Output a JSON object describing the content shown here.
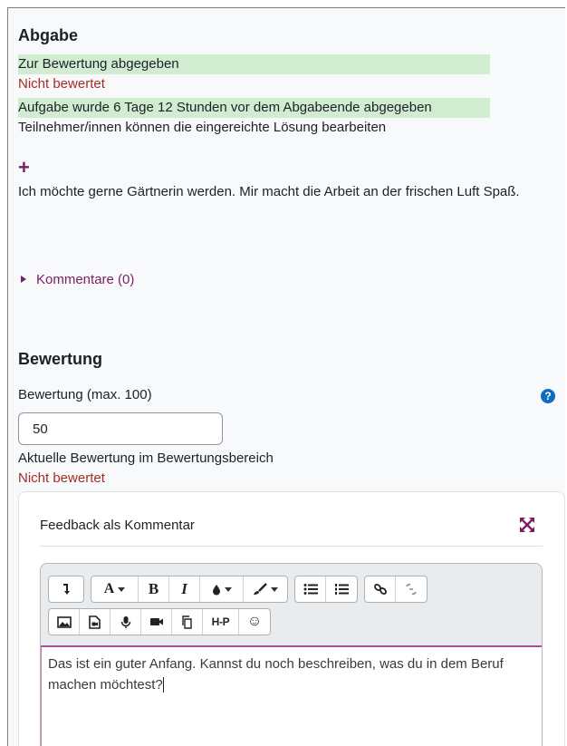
{
  "submission": {
    "heading": "Abgabe",
    "status_submitted": "Zur Bewertung abgegeben",
    "status_grading": "Nicht bewertet",
    "timing": "Aufgabe wurde 6 Tage 12 Stunden vor dem Abgabeende abgegeben",
    "editable": "Teilnehmer/innen können die eingereichte Lösung bearbeiten",
    "expand_symbol": "+",
    "text": "Ich möchte gerne Gärtnerin werden. Mir macht die Arbeit an der frischen Luft Spaß.",
    "comments_label": "Kommentare (0)"
  },
  "grading": {
    "heading": "Bewertung",
    "grade_label": "Bewertung (max. 100)",
    "grade_value": "50",
    "current_label": "Aktuelle Bewertung im Bewertungsbereich",
    "current_value": "Nicht bewertet"
  },
  "feedback": {
    "title": "Feedback als Kommentar",
    "toolbar": {
      "font_label": "A",
      "bold_label": "B",
      "italic_label": "I",
      "h5p_label": "H-P",
      "emoji_label": "☺"
    },
    "content_text": "Das ist ein guter Anfang. Kannst du noch beschreiben, was du in dem Beruf machen möchtest?"
  },
  "colors": {
    "success_bg": "#d2ecd2",
    "danger_text": "#a72b2b",
    "brand": "#7b1f62",
    "help_blue": "#0f6cbf"
  }
}
